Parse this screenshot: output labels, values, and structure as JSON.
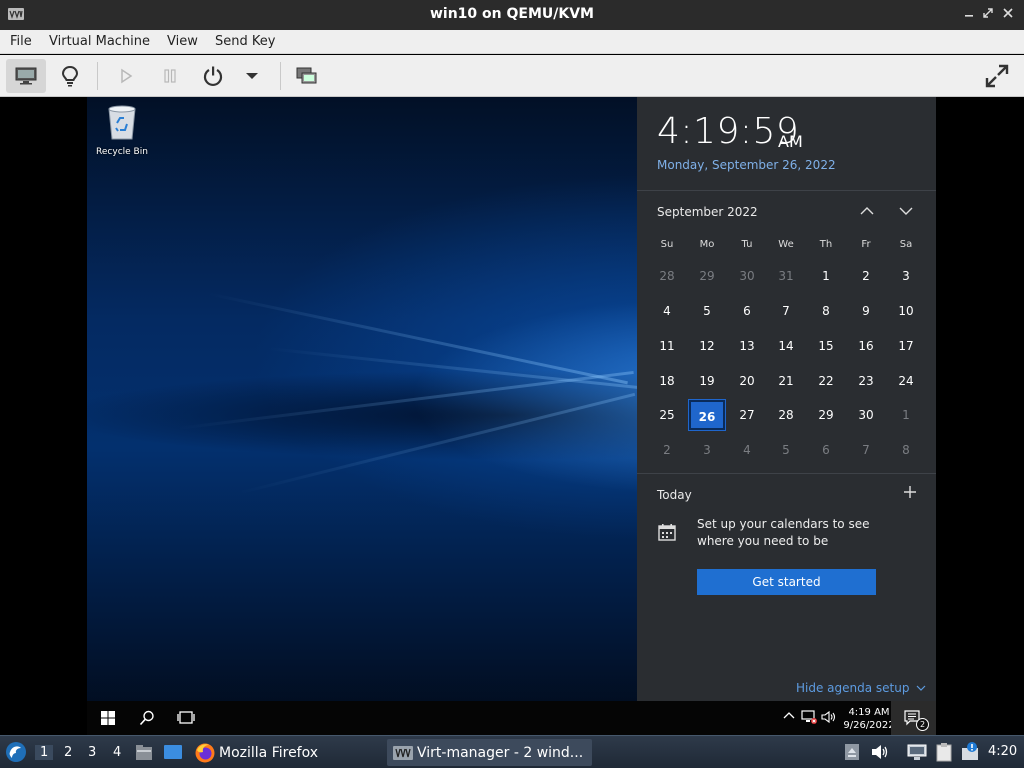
{
  "window": {
    "title": "win10 on QEMU/KVM",
    "controls": [
      "minimize",
      "restore",
      "close"
    ]
  },
  "menubar": {
    "items": [
      "File",
      "Virtual Machine",
      "View",
      "Send Key"
    ]
  },
  "toolbar": {
    "buttons": [
      "show-console",
      "show-details",
      "run",
      "pause",
      "shutdown",
      "shutdown-menu",
      "screenshot",
      "fullscreen"
    ]
  },
  "guest": {
    "desktop": {
      "icons": [
        {
          "label": "Recycle Bin",
          "icon": "recycle-bin-icon"
        }
      ]
    },
    "flyout": {
      "time": "4:19:59",
      "ampm": "AM",
      "date": "Monday, September 26, 2022",
      "month_label": "September 2022",
      "weekdays": [
        "Su",
        "Mo",
        "Tu",
        "We",
        "Th",
        "Fr",
        "Sa"
      ],
      "weeks": [
        [
          "28",
          "29",
          "30",
          "31",
          "1",
          "2",
          "3"
        ],
        [
          "4",
          "5",
          "6",
          "7",
          "8",
          "9",
          "10"
        ],
        [
          "11",
          "12",
          "13",
          "14",
          "15",
          "16",
          "17"
        ],
        [
          "18",
          "19",
          "20",
          "21",
          "22",
          "23",
          "24"
        ],
        [
          "25",
          "26",
          "27",
          "28",
          "29",
          "30",
          "1"
        ],
        [
          "2",
          "3",
          "4",
          "5",
          "6",
          "7",
          "8"
        ]
      ],
      "selected_day": "26",
      "agenda_title": "Today",
      "agenda_message": "Set up your calendars to see where you need to be",
      "get_started_label": "Get started",
      "hide_agenda_label": "Hide agenda setup"
    },
    "taskbar": {
      "clock_time": "4:19 AM",
      "clock_date": "9/26/2022",
      "notification_count": "2"
    }
  },
  "host_panel": {
    "workspaces": [
      "1",
      "2",
      "3",
      "4"
    ],
    "active_workspace": "1",
    "tasks": [
      {
        "label": "Mozilla Firefox",
        "icon": "firefox-icon"
      },
      {
        "label": "Virt-manager - 2 wind...",
        "icon": "virt-manager-icon"
      }
    ],
    "clock": "4:20"
  },
  "colors": {
    "titlebar": "#2b2b2b",
    "flyout_bg": "#2a2d31",
    "accent_blue": "#1f6fd1",
    "date_blue": "#7fb0e8"
  }
}
